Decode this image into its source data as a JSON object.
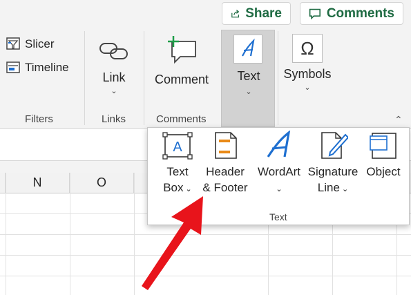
{
  "topbar": {
    "share_label": "Share",
    "comments_label": "Comments"
  },
  "ribbon": {
    "filters": {
      "slicer": "Slicer",
      "timeline": "Timeline",
      "group_label": "Filters"
    },
    "links": {
      "link": "Link",
      "group_label": "Links"
    },
    "comments": {
      "comment": "Comment",
      "group_label": "Comments"
    },
    "text_button": "Text",
    "symbols_button": "Symbols"
  },
  "grid": {
    "columns": [
      "N",
      "O"
    ]
  },
  "text_panel": {
    "items": [
      {
        "line1": "Text",
        "line2": "Box",
        "has_dropdown": true,
        "icon": "text-box-icon"
      },
      {
        "line1": "Header",
        "line2": "& Footer",
        "has_dropdown": false,
        "icon": "header-footer-icon"
      },
      {
        "line1": "WordArt",
        "line2": "",
        "has_dropdown": true,
        "icon": "wordart-icon"
      },
      {
        "line1": "Signature",
        "line2": "Line",
        "has_dropdown": true,
        "icon": "signature-line-icon"
      },
      {
        "line1": "Object",
        "line2": "",
        "has_dropdown": false,
        "icon": "object-icon"
      }
    ],
    "group_label": "Text"
  },
  "colors": {
    "accent": "#1f6b43",
    "arrow": "#e8141b",
    "icon_blue": "#1e6fd0",
    "icon_orange": "#e98a17"
  }
}
